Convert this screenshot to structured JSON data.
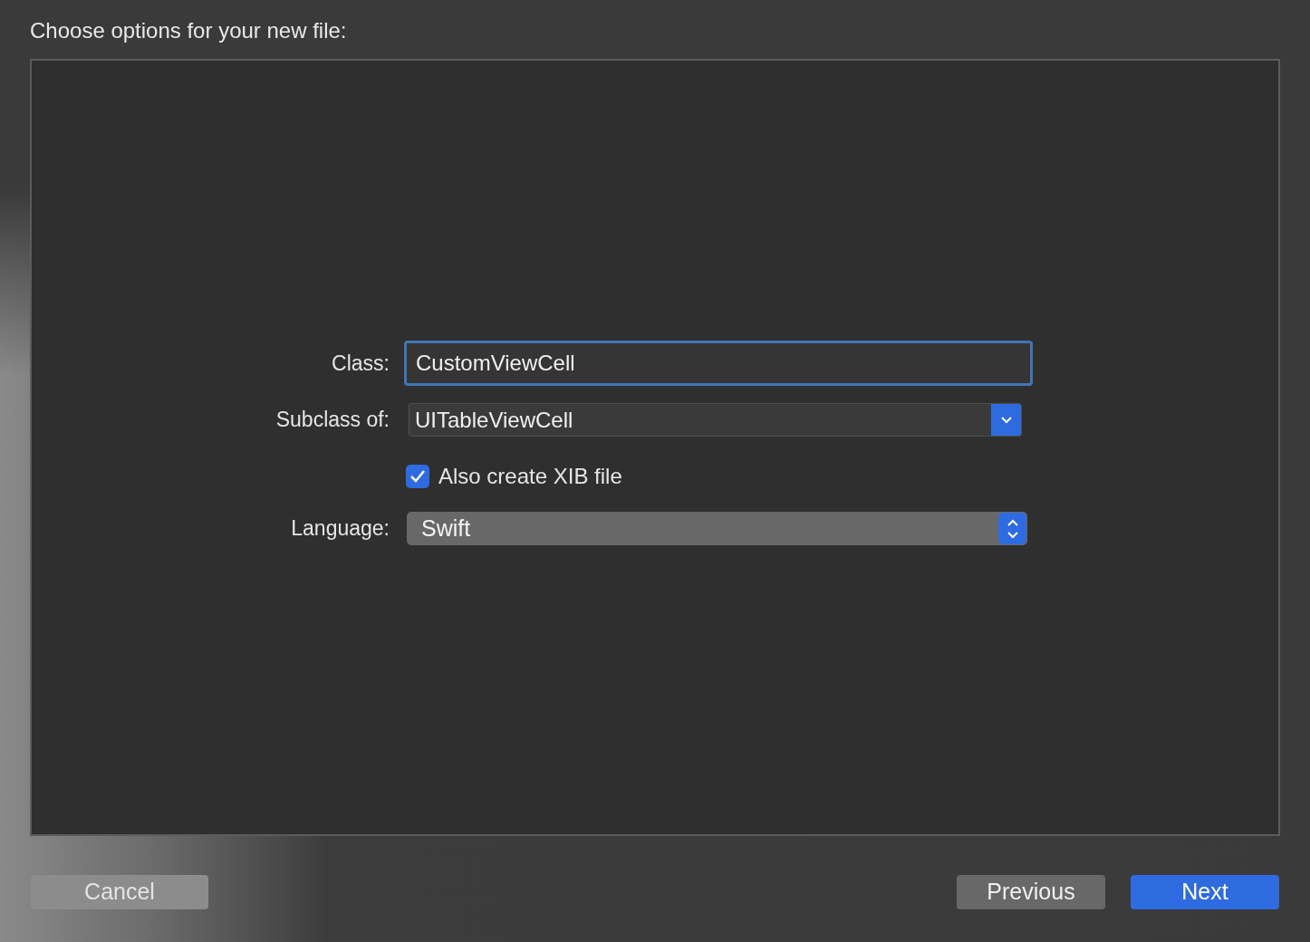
{
  "title": "Choose options for your new file:",
  "form": {
    "class": {
      "label": "Class:",
      "value": "CustomViewCell",
      "focused": true
    },
    "subclass": {
      "label": "Subclass of:",
      "value": "UITableViewCell"
    },
    "xib": {
      "label": "Also create XIB file",
      "checked": true
    },
    "language": {
      "label": "Language:",
      "value": "Swift"
    }
  },
  "buttons": [
    {
      "label": "Cancel",
      "kind": "cancel"
    },
    {
      "label": "Previous",
      "kind": "normal"
    },
    {
      "label": "Next",
      "kind": "primary"
    }
  ]
}
